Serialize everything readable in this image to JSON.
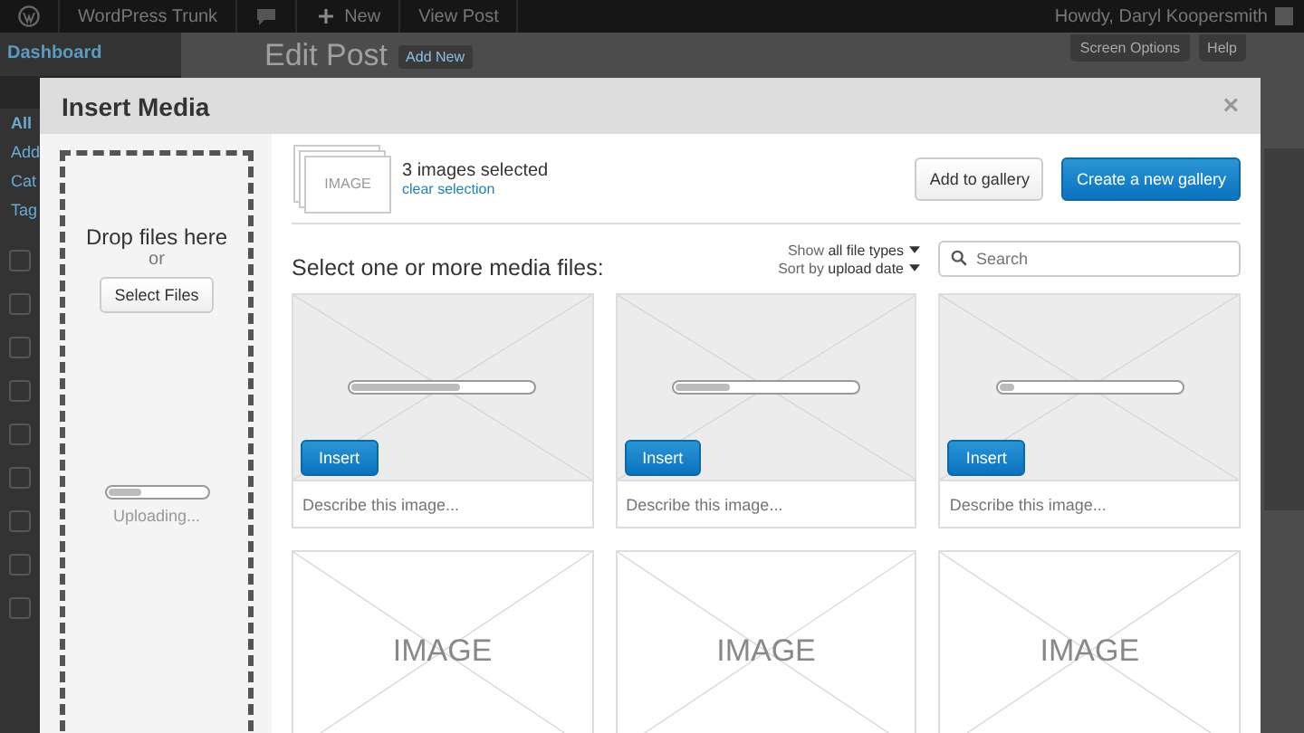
{
  "admin_bar": {
    "site_name": "WordPress Trunk",
    "new_label": "New",
    "view_post": "View Post",
    "greeting": "Howdy, Daryl Koopersmith"
  },
  "admin_menu": {
    "top": "Dashboard",
    "submenu": [
      "All",
      "Add",
      "Cat",
      "Tag"
    ]
  },
  "page": {
    "title": "Edit Post",
    "add_new": "Add New",
    "screen_options": "Screen Options",
    "help": "Help"
  },
  "modal": {
    "title": "Insert Media",
    "close": "×",
    "uploader": {
      "heading": "Drop files here",
      "or": "or",
      "button": "Select Files",
      "level": 0.35,
      "status": "Uploading..."
    },
    "selection": {
      "thumb_label": "IMAGE",
      "count": "3 images selected",
      "clear": "clear selection"
    },
    "buttons": [
      {
        "label": "Add to gallery",
        "kind": "secondary"
      },
      {
        "label": "Create a new gallery",
        "kind": "primary"
      }
    ],
    "prompt": "Select one or more media files:",
    "filters": [
      "Show **all file types**",
      "Sort by **upload date**"
    ],
    "search": {
      "placeholder": "Search"
    },
    "items": [
      {
        "kind": "uploading",
        "level": 0.6,
        "button": "Insert",
        "placeholder": "Describe this image..."
      },
      {
        "kind": "uploading",
        "level": 0.3,
        "button": "Insert",
        "placeholder": "Describe this image..."
      },
      {
        "kind": "uploading",
        "level": 0.08,
        "button": "Insert",
        "placeholder": "Describe this image..."
      },
      {
        "kind": "image",
        "label": "IMAGE"
      },
      {
        "kind": "image",
        "label": "IMAGE"
      },
      {
        "kind": "image",
        "label": "IMAGE"
      }
    ]
  }
}
